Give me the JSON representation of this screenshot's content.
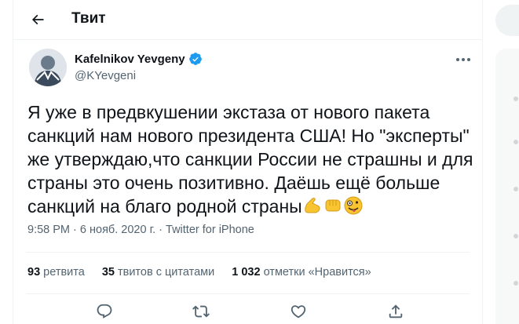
{
  "header": {
    "title": "Твит",
    "back_icon": "arrow-left-icon"
  },
  "author": {
    "display_name": "Kafelnikov Yevgeny",
    "handle": "@KYevgeni",
    "verified": true,
    "avatar_icon": "user-avatar"
  },
  "tweet": {
    "text": "Я уже в предвкушении экстаза от нового пакета санкций нам нового президента США! Но \"эксперты\" же утверждаю,что санкции России не страшны и для страны это очень позитивно. Даёшь ещё больше санкций на благо родной страны",
    "emojis": [
      "flexed-biceps",
      "oncoming-fist",
      "zany-face"
    ]
  },
  "meta": {
    "time": "9:58 PM",
    "separator": "·",
    "date": "6 нояб. 2020 г.",
    "source": "Twitter for iPhone"
  },
  "stats": {
    "retweets_count": "93",
    "retweets_label": "ретвита",
    "quotes_count": "35",
    "quotes_label": "твитов с цитатами",
    "likes_count": "1 032",
    "likes_label": "отметки «Нравится»"
  },
  "actions": [
    "reply-icon",
    "retweet-icon",
    "like-icon",
    "share-icon"
  ],
  "colors": {
    "accent": "#1d9bf0",
    "text": "#0f1419",
    "secondary": "#536471",
    "border": "#eff3f4"
  }
}
